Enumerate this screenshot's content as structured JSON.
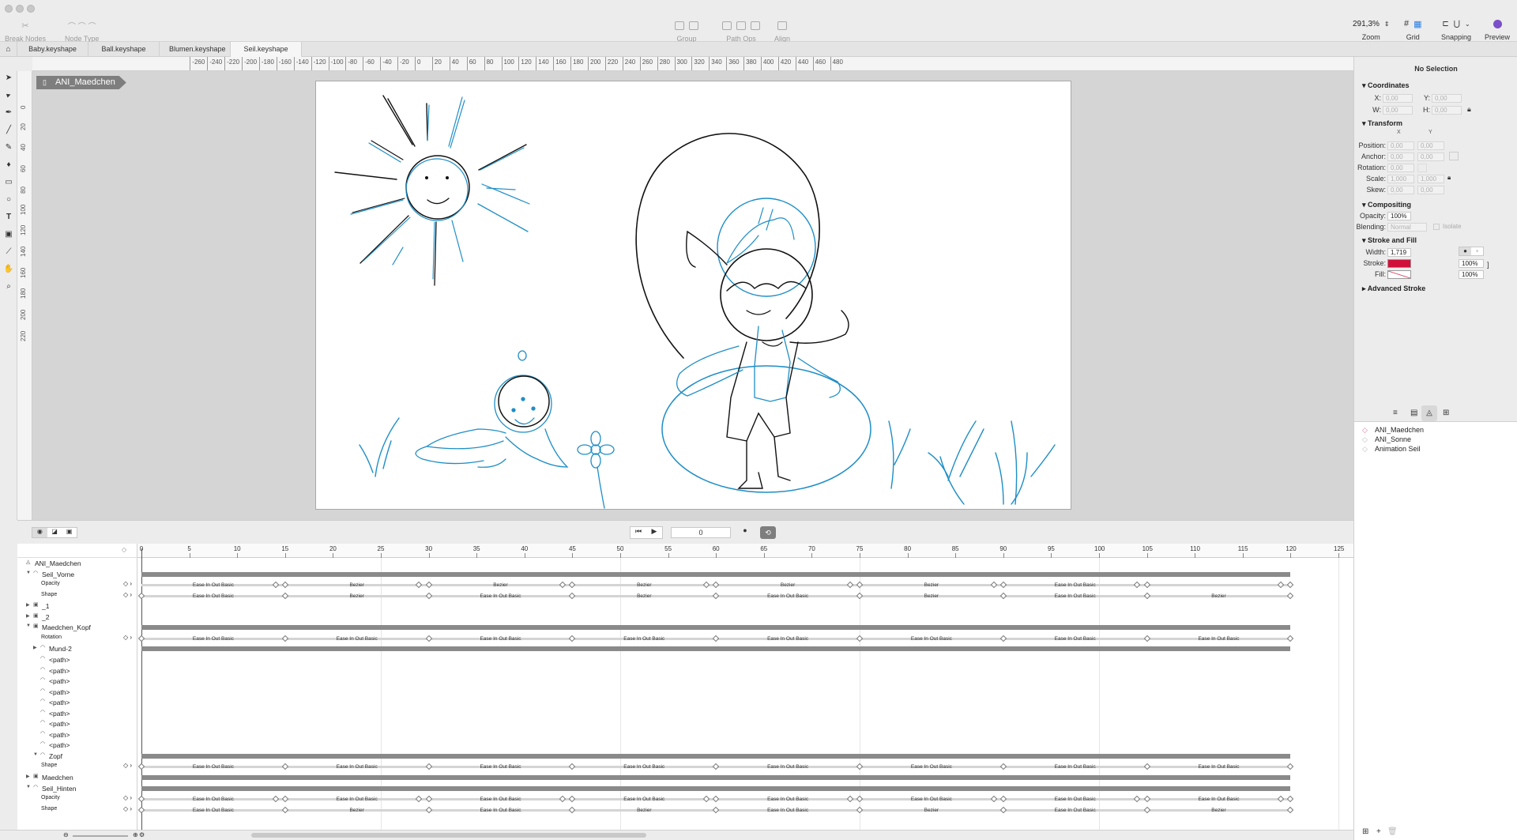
{
  "toolbar": {
    "groups": [
      {
        "label": "Break Nodes",
        "icon": "break-nodes-icon"
      },
      {
        "label": "Node Type",
        "icon": "node-type-icon"
      },
      {
        "label": "Group",
        "icon": "group-icon"
      },
      {
        "label": "Path Ops",
        "icon": "path-ops-icon"
      },
      {
        "label": "Align",
        "icon": "align-icon"
      }
    ],
    "zoom_value": "291,3%",
    "zoom_label": "Zoom",
    "grid_label": "Grid",
    "snapping_label": "Snapping",
    "preview_label": "Preview"
  },
  "tabs": [
    "Baby.keyshape",
    "Ball.keyshape",
    "Blumen.keyshape",
    "Seil.keyshape"
  ],
  "active_tab": 3,
  "ruler": {
    "h": [
      "-260",
      "-240",
      "-220",
      "-200",
      "-180",
      "-160",
      "-140",
      "-120",
      "-100",
      "-80",
      "-60",
      "-40",
      "-20",
      "0",
      "20",
      "40",
      "60",
      "80",
      "100",
      "120",
      "140",
      "160",
      "180",
      "200",
      "220",
      "240",
      "260",
      "280",
      "300",
      "320",
      "340",
      "360",
      "380",
      "400",
      "420",
      "440",
      "460",
      "480"
    ],
    "h0": "0",
    "v": [
      "0",
      "20",
      "40",
      "60",
      "80",
      "100",
      "120",
      "140",
      "160",
      "180",
      "200",
      "220"
    ]
  },
  "breadcrumb": "ANI_Maedchen",
  "inspector": {
    "title": "No Selection",
    "coordinates": {
      "header": "Coordinates",
      "x_label": "X:",
      "x": "0,00",
      "y_label": "Y:",
      "y": "0,00",
      "w_label": "W:",
      "w": "0,00",
      "h_label": "H:",
      "h": "0,00"
    },
    "transform": {
      "header": "Transform",
      "col_x": "X",
      "col_y": "Y",
      "position_label": "Position:",
      "anchor_label": "Anchor:",
      "rotation_label": "Rotation:",
      "scale_label": "Scale:",
      "skew_label": "Skew:",
      "position_x": "0,00",
      "position_y": "0,00",
      "anchor_x": "0,00",
      "anchor_y": "0,00",
      "rotation": "0,00",
      "scale_x": "1,000",
      "scale_y": "1,000",
      "skew_x": "0,00",
      "skew_y": "0,00"
    },
    "compositing": {
      "header": "Compositing",
      "opacity_label": "Opacity:",
      "opacity": "100%",
      "blending_label": "Blending:",
      "blending": "Normal",
      "isolate": "Isolate"
    },
    "stroke_fill": {
      "header": "Stroke and Fill",
      "width_label": "Width:",
      "width": "1,719",
      "stroke_label": "Stroke:",
      "stroke_color": "#d0103a",
      "stroke_opacity": "100%",
      "fill_label": "Fill:",
      "fill_opacity": "100%"
    },
    "advanced": "Advanced Stroke"
  },
  "outline": {
    "items": [
      "ANI_Maedchen",
      "ANI_Sonne",
      "Animation Seil"
    ]
  },
  "timeline": {
    "current_time": "0",
    "ticks": [
      "0",
      "5",
      "10",
      "15",
      "20",
      "25",
      "30",
      "35",
      "40",
      "45",
      "50",
      "55",
      "60",
      "65",
      "70",
      "75",
      "80",
      "85",
      "90",
      "95",
      "100",
      "105",
      "110",
      "115",
      "120",
      "125"
    ],
    "layers": [
      {
        "name": "ANI_Maedchen",
        "indent": 0,
        "arrow": "",
        "kind": "root"
      },
      {
        "name": "Seil_Vorne",
        "indent": 1,
        "arrow": "▼",
        "kind": "shape"
      },
      {
        "name": "Opacity",
        "indent": 3,
        "arrow": "",
        "kind": "prop"
      },
      {
        "name": "Shape",
        "indent": 3,
        "arrow": "",
        "kind": "prop"
      },
      {
        "name": "_1",
        "indent": 1,
        "arrow": "▶",
        "kind": "group"
      },
      {
        "name": "_2",
        "indent": 1,
        "arrow": "▶",
        "kind": "group"
      },
      {
        "name": "Maedchen_Kopf",
        "indent": 1,
        "arrow": "▼",
        "kind": "group"
      },
      {
        "name": "Rotation",
        "indent": 3,
        "arrow": "",
        "kind": "prop"
      },
      {
        "name": "Mund-2",
        "indent": 2,
        "arrow": "▶",
        "kind": "shape"
      },
      {
        "name": "<path>",
        "indent": 2,
        "arrow": "",
        "kind": "shape"
      },
      {
        "name": "<path>",
        "indent": 2,
        "arrow": "",
        "kind": "shape"
      },
      {
        "name": "<path>",
        "indent": 2,
        "arrow": "",
        "kind": "shape"
      },
      {
        "name": "<path>",
        "indent": 2,
        "arrow": "",
        "kind": "shape"
      },
      {
        "name": "<path>",
        "indent": 2,
        "arrow": "",
        "kind": "shape"
      },
      {
        "name": "<path>",
        "indent": 2,
        "arrow": "",
        "kind": "shape"
      },
      {
        "name": "<path>",
        "indent": 2,
        "arrow": "",
        "kind": "shape"
      },
      {
        "name": "<path>",
        "indent": 2,
        "arrow": "",
        "kind": "shape"
      },
      {
        "name": "<path>",
        "indent": 2,
        "arrow": "",
        "kind": "shape"
      },
      {
        "name": "Zopf",
        "indent": 2,
        "arrow": "▼",
        "kind": "shape"
      },
      {
        "name": "Shape",
        "indent": 3,
        "arrow": "",
        "kind": "prop"
      },
      {
        "name": "Maedchen",
        "indent": 1,
        "arrow": "▶",
        "kind": "group"
      },
      {
        "name": "Seil_Hinten",
        "indent": 1,
        "arrow": "▼",
        "kind": "shape"
      },
      {
        "name": "Opacity",
        "indent": 3,
        "arrow": "",
        "kind": "prop"
      },
      {
        "name": "Shape",
        "indent": 3,
        "arrow": "",
        "kind": "prop"
      }
    ],
    "tracks": [
      {
        "row": 2,
        "keys": [
          14,
          15,
          29,
          30,
          44,
          45,
          59,
          60,
          74,
          75,
          89,
          90,
          104,
          105,
          119,
          120
        ],
        "labels": [
          "Ease In Out Basic",
          "Bezier",
          "Bezier",
          "Bezier",
          "Bezier",
          "Bezier",
          "Ease In Out Basic"
        ]
      },
      {
        "row": 3,
        "keys": [
          0,
          15,
          30,
          45,
          60,
          75,
          90,
          105,
          120
        ],
        "labels": [
          "Ease In Out Basic",
          "Bezier",
          "Ease In Out Basic",
          "Bezier",
          "Ease In Out Basic",
          "Bezier",
          "Ease In Out Basic",
          "Bezier"
        ]
      },
      {
        "row": 7,
        "keys": [
          0,
          15,
          30,
          45,
          60,
          75,
          90,
          105,
          120
        ],
        "labels": [
          "Ease In Out Basic",
          "Ease In Out Basic",
          "Ease In Out Basic",
          "Ease In Out Basic",
          "Ease In Out Basic",
          "Ease In Out Basic",
          "Ease In Out Basic",
          "Ease In Out Basic"
        ]
      },
      {
        "row": 19,
        "keys": [
          0,
          15,
          30,
          45,
          60,
          75,
          90,
          105,
          120
        ],
        "labels": [
          "Ease In Out Basic",
          "Ease In Out Basic",
          "Ease In Out Basic",
          "Ease In Out Basic",
          "Ease In Out Basic",
          "Ease In Out Basic",
          "Ease In Out Basic",
          "Ease In Out Basic"
        ]
      },
      {
        "row": 22,
        "keys": [
          0,
          14,
          15,
          29,
          30,
          44,
          45,
          59,
          60,
          74,
          75,
          89,
          90,
          104,
          105,
          119,
          120
        ],
        "labels": [
          "Ease In Out Basic",
          "Ease In Out Basic",
          "Ease In Out Basic",
          "Ease In Out Basic",
          "Ease In Out Basic",
          "Ease In Out Basic",
          "Ease In Out Basic",
          "Ease In Out Basic"
        ]
      },
      {
        "row": 23,
        "keys": [
          0,
          15,
          30,
          45,
          60,
          75,
          90,
          105,
          120
        ],
        "labels": [
          "Ease In Out Basic",
          "Bezier",
          "Ease In Out Basic",
          "Bezier",
          "Ease In Out Basic",
          "Bezier",
          "Ease In Out Basic",
          "Bezier"
        ]
      }
    ],
    "bars": [
      1,
      6,
      8,
      18,
      20,
      21
    ]
  }
}
